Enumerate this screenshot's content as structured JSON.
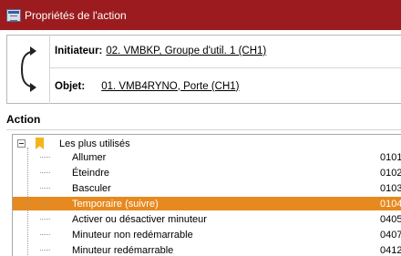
{
  "window": {
    "title": "Propriétés de l'action"
  },
  "header": {
    "initiator_label": "Initiateur:",
    "initiator_value": "02. VMBKP, Groupe d'util. 1 (CH1)",
    "object_label": "Objet:",
    "object_value": "01. VMB4RYNO, Porte (CH1)"
  },
  "action_section": {
    "title": "Action"
  },
  "tree": {
    "root_label": "Les plus utilisés",
    "items": [
      {
        "label": "Allumer",
        "code": "0101"
      },
      {
        "label": "Éteindre",
        "code": "0102"
      },
      {
        "label": "Basculer",
        "code": "0103"
      },
      {
        "label": "Temporaire (suivre)",
        "code": "0104"
      },
      {
        "label": "Activer ou désactiver minuteur",
        "code": "0405"
      },
      {
        "label": "Minuteur non redémarrable",
        "code": "0407"
      },
      {
        "label": "Minuteur redémarrable",
        "code": "0412"
      }
    ],
    "selected_index": 3
  },
  "colors": {
    "titlebar": "#9b1b1e",
    "selection": "#e6891e",
    "bookmark": "#f3b51c"
  }
}
